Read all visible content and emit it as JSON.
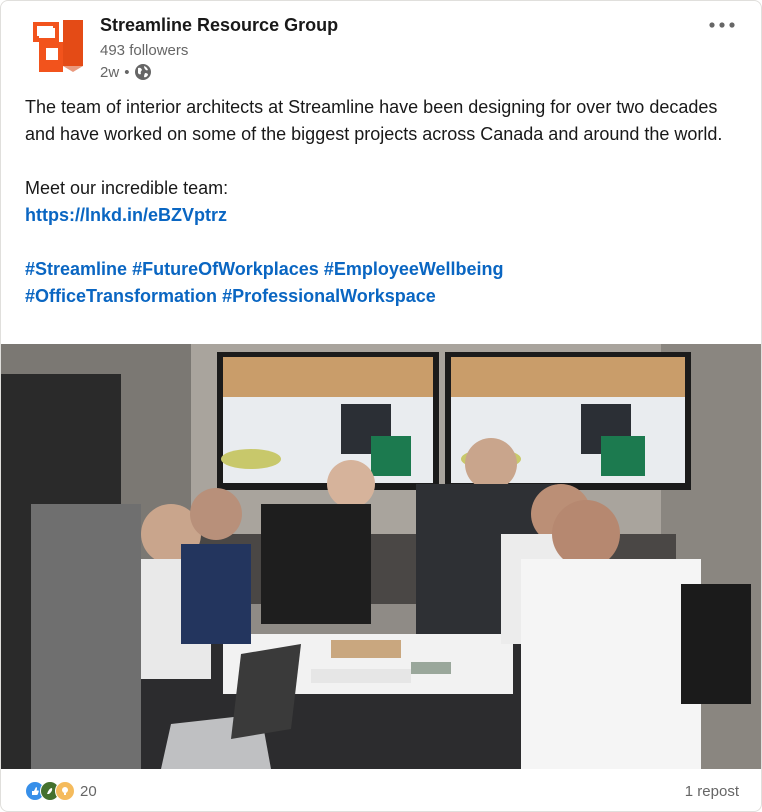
{
  "post": {
    "company_name": "Streamline Resource Group",
    "followers": "493 followers",
    "time_ago": "2w",
    "separator": "•",
    "icons": {
      "logo": "streamline-logo",
      "visibility": "globe-icon",
      "menu": "more-options-icon"
    },
    "colors": {
      "brand_orange": "#f2531c",
      "link_blue": "#0a66c2",
      "secondary_text": "#666666"
    },
    "text": {
      "paragraph1": "The team of interior architects at Streamline have been designing for over two decades and have worked on some of the biggest projects across Canada and around the world.",
      "paragraph2": "Meet our incredible team:",
      "link": "https://lnkd.in/eBZVptrz",
      "hashtags_line1": [
        "#Streamline",
        "#FutureOfWorkplaces",
        "#EmployeeWellbeing"
      ],
      "hashtags_line2": [
        "#OfficeTransformation",
        "#ProfessionalWorkspace"
      ]
    },
    "image": {
      "subject": "office-meeting-photo"
    },
    "social": {
      "reaction_icons": [
        "like-icon",
        "celebrate-icon",
        "insightful-icon"
      ],
      "reactions_count": "20",
      "reposts": "1 repost"
    }
  }
}
